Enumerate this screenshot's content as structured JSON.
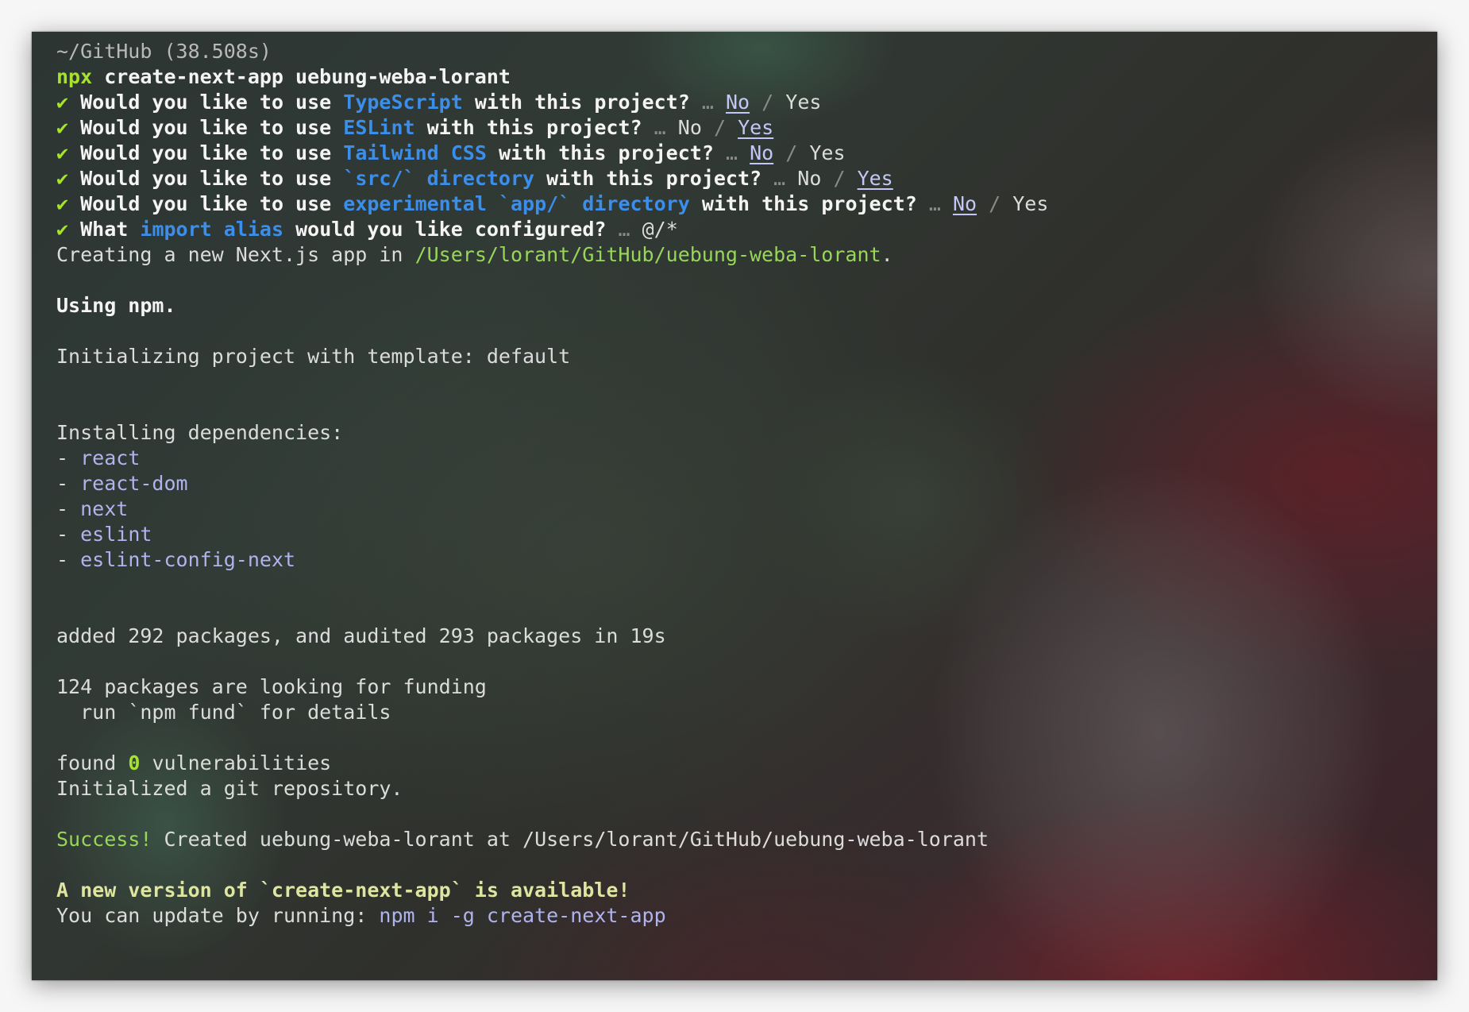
{
  "header": {
    "cwd": "~/GitHub (38.508s)",
    "prompt_cmd": "npx",
    "prompt_args": "create-next-app uebung-weba-lorant"
  },
  "questions": [
    {
      "check": "✔",
      "pre": "Would you like to use",
      "highlight": "TypeScript",
      "post": "with this project?",
      "ellipsis": "…",
      "opt1": "No",
      "sep": "/",
      "opt2": "Yes",
      "selected": "No"
    },
    {
      "check": "✔",
      "pre": "Would you like to use",
      "highlight": "ESLint",
      "post": "with this project?",
      "ellipsis": "…",
      "opt1": "No",
      "sep": "/",
      "opt2": "Yes",
      "selected": "Yes"
    },
    {
      "check": "✔",
      "pre": "Would you like to use",
      "highlight": "Tailwind CSS",
      "post": "with this project?",
      "ellipsis": "…",
      "opt1": "No",
      "sep": "/",
      "opt2": "Yes",
      "selected": "No"
    },
    {
      "check": "✔",
      "pre": "Would you like to use",
      "highlight": "`src/` directory",
      "post": "with this project?",
      "ellipsis": "…",
      "opt1": "No",
      "sep": "/",
      "opt2": "Yes",
      "selected": "Yes"
    },
    {
      "check": "✔",
      "pre": "Would you like to use",
      "highlight": "experimental `app/` directory",
      "post": "with this project?",
      "ellipsis": "…",
      "opt1": "No",
      "sep": "/",
      "opt2": "Yes",
      "selected": "No"
    },
    {
      "check": "✔",
      "pre": "What",
      "highlight": "import alias",
      "post": "would you like configured?",
      "ellipsis": "…",
      "answer": "@/*"
    }
  ],
  "creating": {
    "text": "Creating a new Next.js app in",
    "path": "/Users/lorant/GitHub/uebung-weba-lorant",
    "dot": "."
  },
  "using": "Using npm.",
  "initializing": "Initializing project with template: default",
  "installing": {
    "title": "Installing dependencies:",
    "dash": "-",
    "packages": [
      "react",
      "react-dom",
      "next",
      "eslint",
      "eslint-config-next"
    ]
  },
  "added": "added 292 packages, and audited 293 packages in 19s",
  "funding": {
    "line1": "124 packages are looking for funding",
    "line2": "run `npm fund` for details"
  },
  "vulns": {
    "pre": "found",
    "count": "0",
    "post": "vulnerabilities"
  },
  "git": "Initialized a git repository.",
  "success": {
    "label": "Success!",
    "text": "Created uebung-weba-lorant at /Users/lorant/GitHub/uebung-weba-lorant"
  },
  "update": {
    "title": "A new version of `create-next-app` is available!",
    "text": "You can update by running:",
    "cmd": "npm i -g create-next-app"
  }
}
